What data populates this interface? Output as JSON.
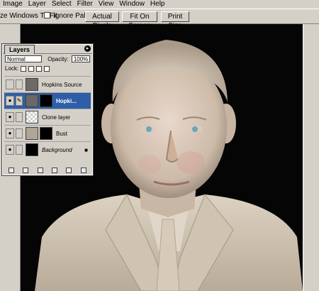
{
  "menus": [
    "Image",
    "Layer",
    "Select",
    "Filter",
    "View",
    "Window",
    "Help"
  ],
  "options": {
    "resize_label": "ze Windows To Fit",
    "ignore_palettes": "Ignore Palettes",
    "buttons": [
      "Actual Pixels",
      "Fit On Screen",
      "Print Size"
    ]
  },
  "layers_panel": {
    "tab": "Layers",
    "blend_mode": "Normal",
    "opacity_label": "Opacity:",
    "opacity_value": "100%",
    "lock_label": "Lock:",
    "layers": [
      {
        "name": "Hopkins Source",
        "visible": false,
        "active": false
      },
      {
        "name": "Hopki...",
        "visible": true,
        "active": true
      },
      {
        "name": "Clone layer",
        "visible": true,
        "active": false
      },
      {
        "name": "Bust",
        "visible": true,
        "active": false
      },
      {
        "name": "Background",
        "visible": true,
        "active": false
      }
    ]
  }
}
